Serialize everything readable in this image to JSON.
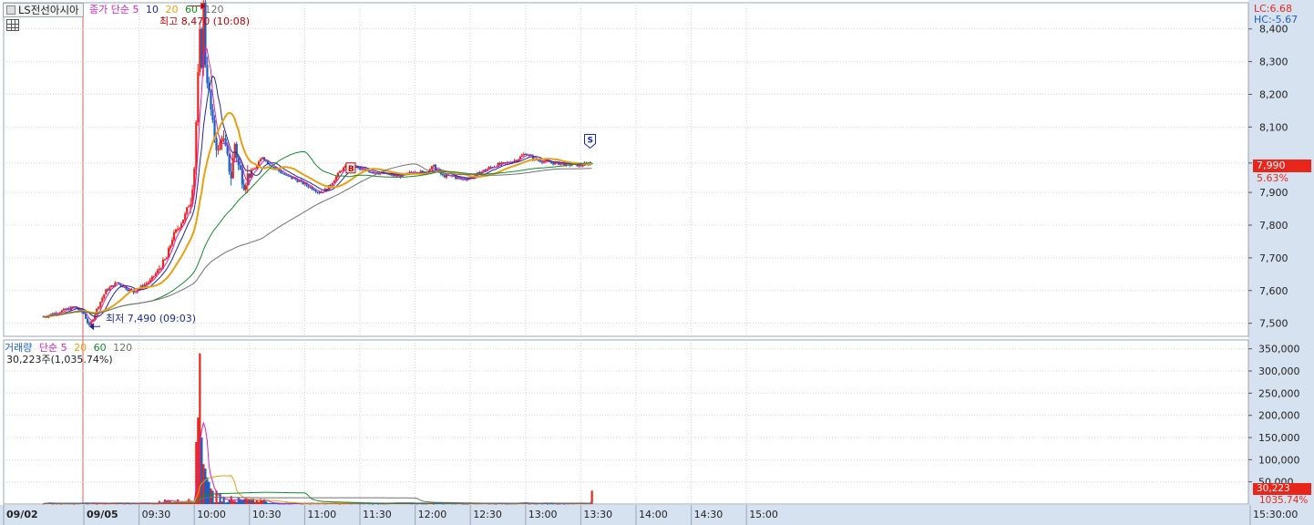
{
  "header": {
    "stock_name": "LS전선아시아",
    "price_ma_label": "종가 단순",
    "price_ma_periods": [
      "5",
      "10",
      "20",
      "60",
      "120"
    ],
    "high_annotation": "최고 8,470 (10:08)",
    "low_annotation": "최저 7,490 (09:03)",
    "lc_label": "LC:6.68",
    "hc_label": "HC:-5.67",
    "last_price_tag": "7,990",
    "last_change_pct": "5.63%",
    "buy_marker": "B",
    "sell_marker": "S"
  },
  "volume_header": {
    "label": "거래량",
    "ma_label": "단순",
    "ma_periods": [
      "5",
      "20",
      "60",
      "120"
    ],
    "current_volume": "30,223주(1,035.74%)",
    "last_volume_tag": "30,223",
    "last_volume_pct": "1035.74%"
  },
  "colors": {
    "up": "#e8261c",
    "down": "#1a5fc4",
    "ma5": "#d020c0",
    "ma10": "#1a2a9a",
    "ma20": "#e8a010",
    "ma60": "#148a2a",
    "ma120": "#707070"
  },
  "chart_data": [
    {
      "type": "candlestick",
      "title": "LS전선아시아",
      "y_ticks": [
        "8,400",
        "8,300",
        "8,200",
        "8,100",
        "7,990",
        "7,900",
        "7,800",
        "7,700",
        "7,600",
        "7,500"
      ],
      "ylim": [
        7460,
        8480
      ],
      "x_ticks": [
        "09/02",
        "09/05",
        "09:30",
        "10:00",
        "10:30",
        "11:00",
        "11:30",
        "12:00",
        "12:30",
        "13:00",
        "13:30",
        "14:00",
        "14:30",
        "15:00",
        "15:30:00"
      ],
      "high": {
        "value": 8470,
        "time": "10:08"
      },
      "low": {
        "value": 7490,
        "time": "09:03"
      },
      "last": 7990,
      "price_path": [
        [
          -22,
          7520
        ],
        [
          -5,
          7550
        ],
        [
          0,
          7530
        ],
        [
          3,
          7490
        ],
        [
          8,
          7555
        ],
        [
          12,
          7600
        ],
        [
          18,
          7625
        ],
        [
          22,
          7610
        ],
        [
          27,
          7595
        ],
        [
          32,
          7615
        ],
        [
          36,
          7630
        ],
        [
          40,
          7660
        ],
        [
          45,
          7700
        ],
        [
          48,
          7760
        ],
        [
          52,
          7800
        ],
        [
          55,
          7830
        ],
        [
          58,
          7880
        ],
        [
          60,
          7980
        ],
        [
          62,
          8250
        ],
        [
          63,
          8380
        ],
        [
          64,
          8300
        ],
        [
          65,
          8470
        ],
        [
          66,
          8300
        ],
        [
          68,
          8200
        ],
        [
          70,
          8100
        ],
        [
          73,
          8020
        ],
        [
          75,
          8080
        ],
        [
          78,
          8000
        ],
        [
          80,
          7950
        ],
        [
          82,
          8050
        ],
        [
          84,
          7980
        ],
        [
          87,
          7930
        ],
        [
          90,
          7960
        ],
        [
          94,
          7980
        ],
        [
          97,
          8010
        ],
        [
          100,
          7990
        ],
        [
          105,
          7970
        ],
        [
          110,
          7950
        ],
        [
          115,
          7940
        ],
        [
          120,
          7925
        ],
        [
          125,
          7910
        ],
        [
          128,
          7900
        ],
        [
          132,
          7910
        ],
        [
          136,
          7940
        ],
        [
          140,
          7970
        ],
        [
          145,
          7985
        ],
        [
          150,
          7970
        ],
        [
          155,
          7965
        ],
        [
          160,
          7960
        ],
        [
          165,
          7955
        ],
        [
          170,
          7950
        ],
        [
          175,
          7955
        ],
        [
          180,
          7965
        ],
        [
          185,
          7960
        ],
        [
          190,
          7980
        ],
        [
          195,
          7950
        ],
        [
          200,
          7950
        ],
        [
          205,
          7940
        ],
        [
          210,
          7945
        ],
        [
          215,
          7960
        ],
        [
          220,
          7975
        ],
        [
          225,
          7985
        ],
        [
          230,
          7990
        ],
        [
          235,
          8000
        ],
        [
          240,
          8020
        ],
        [
          245,
          8000
        ],
        [
          250,
          7995
        ],
        [
          255,
          7990
        ],
        [
          260,
          7988
        ],
        [
          265,
          7985
        ],
        [
          270,
          7983
        ],
        [
          276,
          7990
        ]
      ]
    },
    {
      "type": "bar",
      "title": "거래량",
      "y_ticks": [
        "350,000",
        "300,000",
        "250,000",
        "200,000",
        "150,000",
        "100,000",
        "50,000"
      ],
      "ylim": [
        0,
        370000
      ],
      "last": 30223,
      "spikes": [
        {
          "t": 63,
          "v": 340000,
          "dir": "up"
        },
        {
          "t": 62,
          "v": 195000,
          "dir": "up"
        },
        {
          "t": 61,
          "v": 140000,
          "dir": "up"
        },
        {
          "t": 64,
          "v": 150000,
          "dir": "down"
        },
        {
          "t": 65,
          "v": 90000,
          "dir": "up"
        },
        {
          "t": 66,
          "v": 80000,
          "dir": "down"
        },
        {
          "t": 67,
          "v": 60000,
          "dir": "down"
        },
        {
          "t": 68,
          "v": 50000,
          "dir": "down"
        },
        {
          "t": 69,
          "v": 35000,
          "dir": "up"
        },
        {
          "t": 70,
          "v": 30000,
          "dir": "down"
        },
        {
          "t": 72,
          "v": 30000,
          "dir": "up"
        },
        {
          "t": 74,
          "v": 25000,
          "dir": "down"
        },
        {
          "t": 76,
          "v": 15000,
          "dir": "down"
        },
        {
          "t": 80,
          "v": 18000,
          "dir": "up"
        },
        {
          "t": 84,
          "v": 15000,
          "dir": "down"
        },
        {
          "t": 88,
          "v": 14000,
          "dir": "up"
        },
        {
          "t": 92,
          "v": 12000,
          "dir": "down"
        },
        {
          "t": 276,
          "v": 30223,
          "dir": "up"
        }
      ]
    }
  ]
}
